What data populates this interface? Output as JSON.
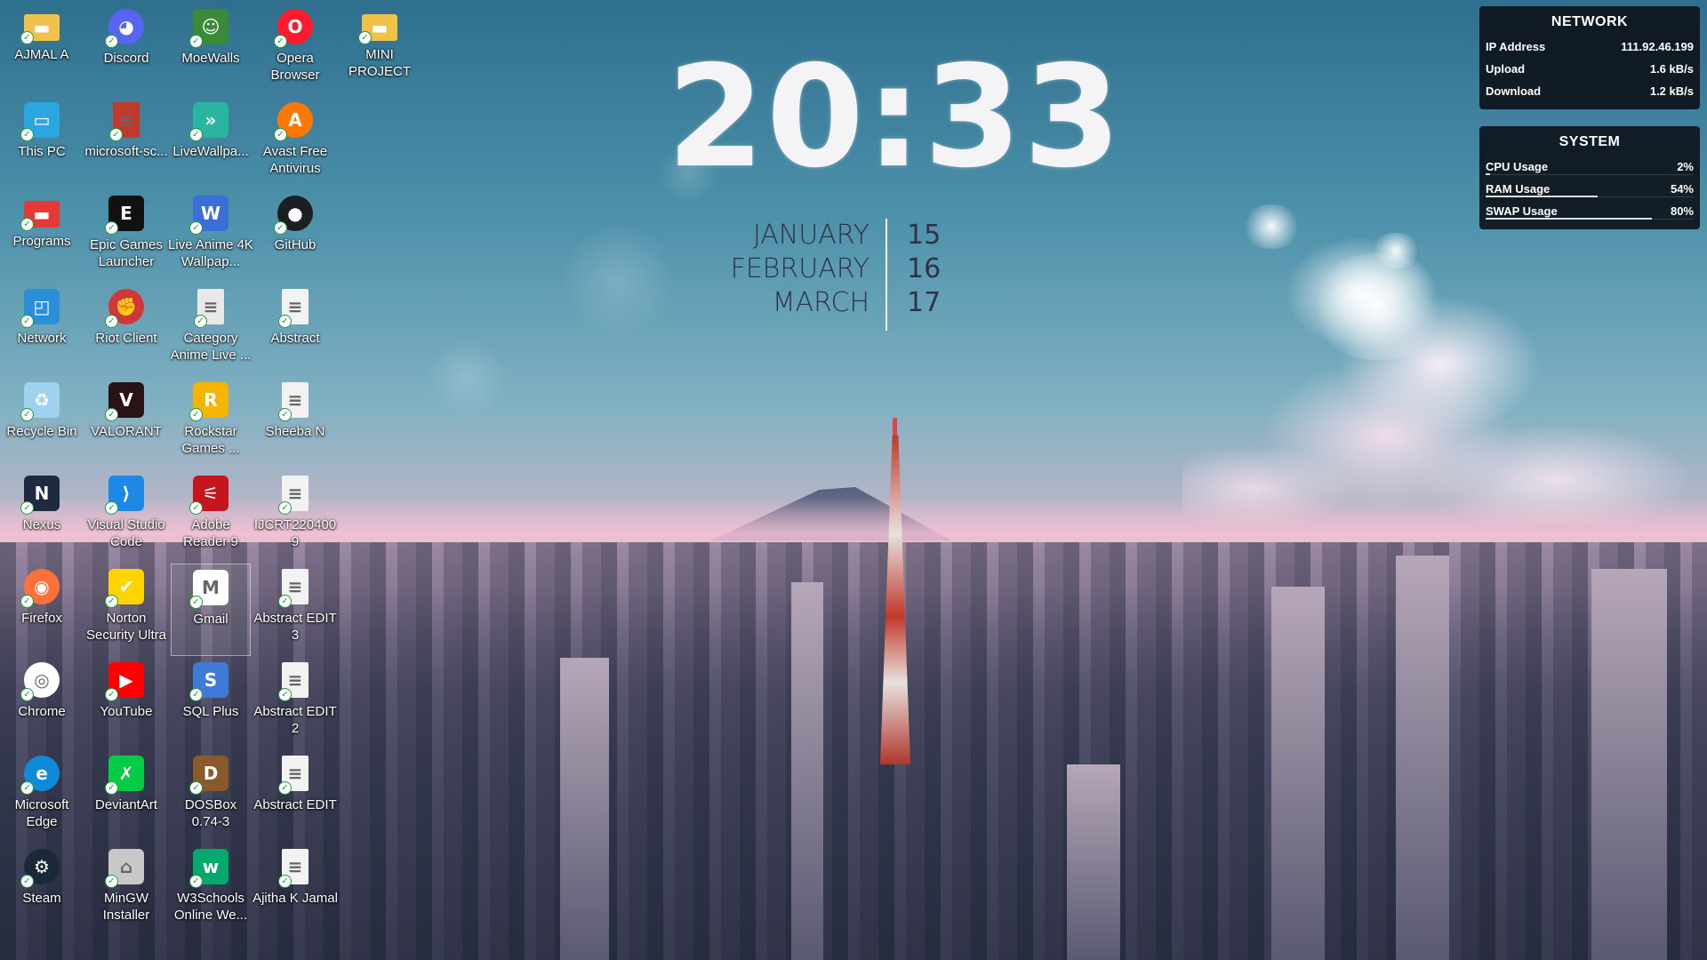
{
  "desktop": {
    "icons": [
      {
        "name": "AJMAL A",
        "icon": "folder-icon",
        "color": "#f1c24a"
      },
      {
        "name": "Discord",
        "icon": "discord-icon",
        "color": "#5865f2"
      },
      {
        "name": "MoeWalls",
        "icon": "moewalls-icon",
        "color": "#3a8a3a"
      },
      {
        "name": "Opera Browser",
        "icon": "opera-icon",
        "color": "#ff1b2d"
      },
      {
        "name": "MINI PROJECT",
        "icon": "folder-icon",
        "color": "#f1c24a"
      },
      {
        "name": "This PC",
        "icon": "computer-icon",
        "color": "#2aa7e0"
      },
      {
        "name": "microsoft-sc...",
        "icon": "document-icon",
        "color": "#c0392b"
      },
      {
        "name": "LiveWallpa...",
        "icon": "livewallpaper-icon",
        "color": "#2bb5a0"
      },
      {
        "name": "Avast Free Antivirus",
        "icon": "avast-icon",
        "color": "#ff7800"
      },
      {
        "name": "Programs",
        "icon": "folder-icon",
        "color": "#e53935"
      },
      {
        "name": "Epic Games Launcher",
        "icon": "epic-games-icon",
        "color": "#111111"
      },
      {
        "name": "Live Anime 4K Wallpap...",
        "icon": "live-anime-icon",
        "color": "#3b6fd8"
      },
      {
        "name": "GitHub",
        "icon": "github-icon",
        "color": "#1b1f23"
      },
      {
        "name": "Network",
        "icon": "network-icon",
        "color": "#2a8fd8"
      },
      {
        "name": "Riot Client",
        "icon": "riot-icon",
        "color": "#d13639"
      },
      {
        "name": "Category Anime Live ...",
        "icon": "document-icon",
        "color": "#e8e8e8"
      },
      {
        "name": "Abstract",
        "icon": "document-icon",
        "color": "#f2f2f2"
      },
      {
        "name": "Recycle Bin",
        "icon": "recycle-bin-icon",
        "color": "#9fd2ef"
      },
      {
        "name": "VALORANT",
        "icon": "valorant-icon",
        "color": "#2a1316"
      },
      {
        "name": "Rockstar Games ...",
        "icon": "rockstar-icon",
        "color": "#f5b400"
      },
      {
        "name": "Sheeba N",
        "icon": "document-icon",
        "color": "#f2f2f2"
      },
      {
        "name": "Nexus",
        "icon": "nexus-icon",
        "color": "#1d2a40"
      },
      {
        "name": "Visual Studio Code",
        "icon": "vscode-icon",
        "color": "#1e88e5"
      },
      {
        "name": "Adobe Reader 9",
        "icon": "adobe-reader-icon",
        "color": "#c4161c"
      },
      {
        "name": "IJCRT2204009",
        "icon": "document-icon",
        "color": "#f2f2f2"
      },
      {
        "name": "Firefox",
        "icon": "firefox-icon",
        "color": "#ff7139"
      },
      {
        "name": "Norton Security Ultra",
        "icon": "norton-icon",
        "color": "#ffd400"
      },
      {
        "name": "Gmail",
        "icon": "gmail-icon",
        "color": "#ffffff"
      },
      {
        "name": "Abstract EDIT 3",
        "icon": "document-icon",
        "color": "#f2f2f2"
      },
      {
        "name": "Chrome",
        "icon": "chrome-icon",
        "color": "#ffffff"
      },
      {
        "name": "YouTube",
        "icon": "youtube-icon",
        "color": "#ff0000"
      },
      {
        "name": "SQL Plus",
        "icon": "sqlplus-icon",
        "color": "#3e7bd6"
      },
      {
        "name": "Abstract EDIT 2",
        "icon": "document-icon",
        "color": "#f2f2f2"
      },
      {
        "name": "Microsoft Edge",
        "icon": "edge-icon",
        "color": "#0f8ad8"
      },
      {
        "name": "DeviantArt",
        "icon": "deviantart-icon",
        "color": "#05cc47"
      },
      {
        "name": "DOSBox 0.74-3",
        "icon": "dosbox-icon",
        "color": "#8a5a2b"
      },
      {
        "name": "Abstract EDIT",
        "icon": "document-icon",
        "color": "#f2f2f2"
      },
      {
        "name": "Steam",
        "icon": "steam-icon",
        "color": "#1b2838"
      },
      {
        "name": "MinGW Installer",
        "icon": "mingw-icon",
        "color": "#c8c8c8"
      },
      {
        "name": "W3Schools Online We...",
        "icon": "w3schools-icon",
        "color": "#04aa6d"
      },
      {
        "name": "Ajitha K Jamal",
        "icon": "document-icon",
        "color": "#f2f2f2"
      }
    ]
  },
  "clock": {
    "time": "20:33",
    "months": [
      "JANUARY",
      "FEBRUARY",
      "MARCH"
    ],
    "days": [
      "15",
      "16",
      "17"
    ]
  },
  "network_widget": {
    "title": "NETWORK",
    "rows": [
      {
        "label": "IP Address",
        "value": "111.92.46.199"
      },
      {
        "label": "Upload",
        "value": "1.6 kB/s"
      },
      {
        "label": "Download",
        "value": "1.2 kB/s"
      }
    ]
  },
  "system_widget": {
    "title": "SYSTEM",
    "rows": [
      {
        "label": "CPU Usage",
        "value": "2%",
        "level": 0.02
      },
      {
        "label": "RAM Usage",
        "value": "54%",
        "level": 0.54
      },
      {
        "label": "SWAP Usage",
        "value": "80%",
        "level": 0.8
      }
    ]
  },
  "colors": {
    "widget_bg": "#0a0e14",
    "clock_text": "#f4f4f6",
    "calendar_text": "#2d3447"
  }
}
